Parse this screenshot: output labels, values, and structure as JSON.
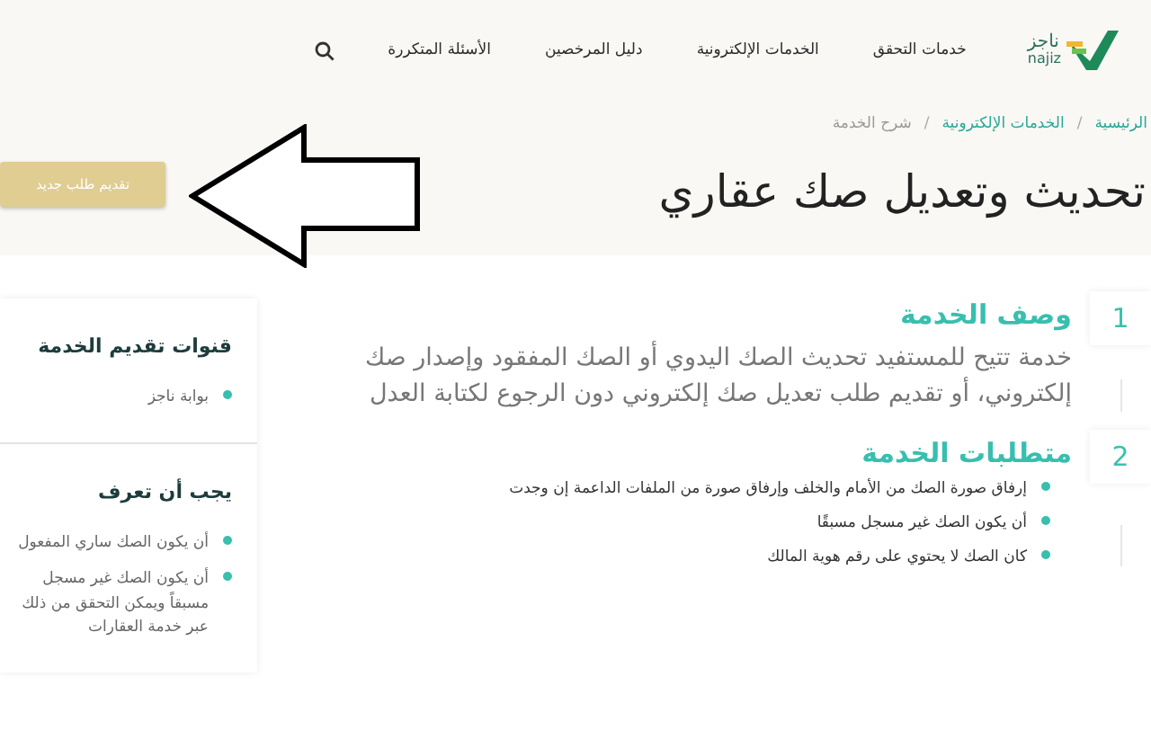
{
  "header": {
    "logo": {
      "arabic": "ناجز",
      "latin": "najiz"
    },
    "nav": [
      {
        "label": "خدمات التحقق"
      },
      {
        "label": "الخدمات الإلكترونية"
      },
      {
        "label": "دليل المرخصين"
      },
      {
        "label": "الأسئلة المتكررة"
      }
    ],
    "breadcrumb": [
      {
        "label": "الرئيسية",
        "current": false
      },
      {
        "label": "الخدمات الإلكترونية",
        "current": false
      },
      {
        "label": "شرح الخدمة",
        "current": true
      }
    ],
    "breadcrumb_separator": "/"
  },
  "page_title": "تحديث وتعديل صك عقاري",
  "new_request_button": "تقديم طلب جديد",
  "sections": [
    {
      "number": "1",
      "title": "وصف الخدمة",
      "kind": "paragraph",
      "text": "خدمة تتيح للمستفيد تحديث الصك اليدوي أو الصك المفقود وإصدار صك إلكتروني، أو تقديم طلب تعديل صك إلكتروني دون الرجوع لكتابة العدل"
    },
    {
      "number": "2",
      "title": "متطلبات الخدمة",
      "kind": "list",
      "items": [
        "إرفاق صورة الصك من الأمام والخلف وإرفاق صورة من الملفات الداعمة إن وجدت",
        "أن يكون الصك غير مسجل مسبقًا",
        "كان الصك لا يحتوي على رقم هوية المالك"
      ]
    }
  ],
  "sidebar": [
    {
      "title": "قنوات تقديم الخدمة",
      "items": [
        "بوابة ناجز"
      ]
    },
    {
      "title": "يجب أن تعرف",
      "items": [
        "أن يكون الصك ساري المفعول",
        "أن يكون الصك غير مسجل مسبقاً ويمكن التحقق من ذلك عبر خدمة العقارات"
      ]
    }
  ]
}
